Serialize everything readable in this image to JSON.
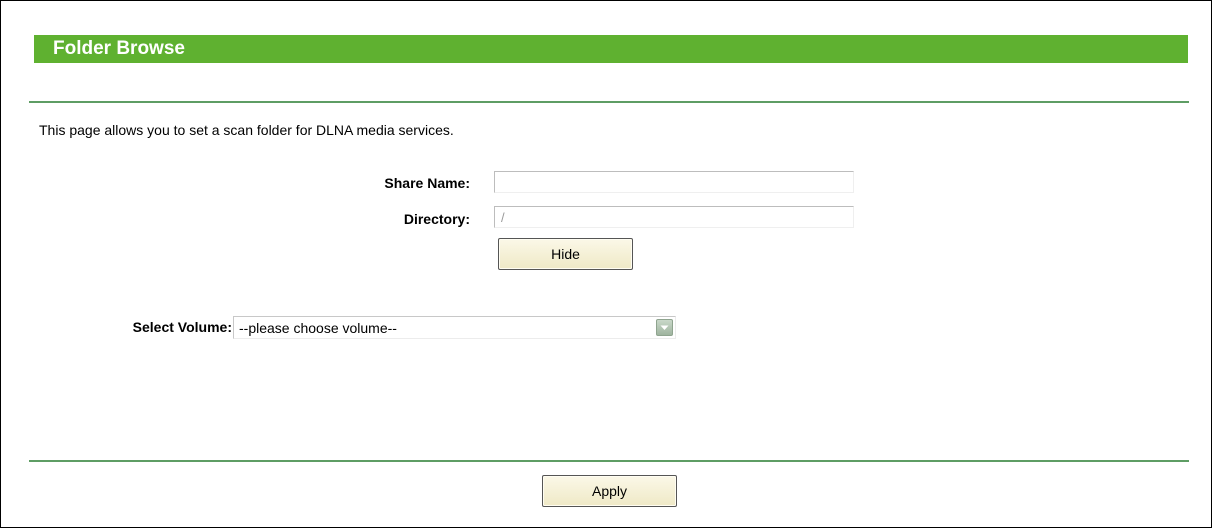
{
  "header": {
    "title": "Folder Browse"
  },
  "description": "This page allows you to set a scan folder for DLNA media services.",
  "form": {
    "share_name_label": "Share Name:",
    "share_name_value": "",
    "directory_label": "Directory:",
    "directory_value": "/",
    "hide_button": "Hide",
    "select_volume_label": "Select Volume:",
    "select_volume_value": "--please choose volume--"
  },
  "footer": {
    "apply_button": "Apply"
  },
  "icons": {
    "dropdown": "chevron-down-icon"
  },
  "colors": {
    "title_bar": "#5fb130",
    "divider": "#5e9d64",
    "button_bg": "#f4f0d8"
  }
}
